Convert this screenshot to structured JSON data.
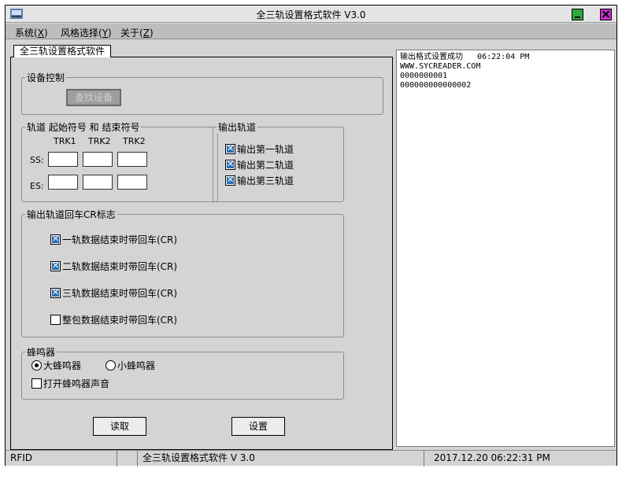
{
  "window": {
    "title": "全三轨设置格式软件 V3.0"
  },
  "menu": [
    {
      "label": "系统",
      "key": "X"
    },
    {
      "label": "风格选择",
      "key": "Y"
    },
    {
      "label": "关于",
      "key": "Z"
    }
  ],
  "tab": {
    "label": "全三轨设置格式软件"
  },
  "device": {
    "title": "设备控制",
    "find_button": "查找设备"
  },
  "sentinels": {
    "title": "轨道 起始符号 和 结束符号",
    "tracks": [
      "TRK1",
      "TRK2",
      "TRK2"
    ],
    "ss_label": "SS:",
    "es_label": "ES:",
    "ss_values": [
      "",
      "",
      ""
    ],
    "es_values": [
      "",
      "",
      ""
    ]
  },
  "output_tracks": {
    "title": "输出轨道",
    "items": [
      {
        "label": "输出第一轨道",
        "checked": true
      },
      {
        "label": "输出第二轨道",
        "checked": true
      },
      {
        "label": "输出第三轨道",
        "checked": true
      }
    ]
  },
  "cr": {
    "title": "输出轨道回车CR标志",
    "items": [
      {
        "label": "一轨数据结束时带回车(CR)",
        "checked": true
      },
      {
        "label": "二轨数据结束时带回车(CR)",
        "checked": true
      },
      {
        "label": "三轨数据结束时带回车(CR)",
        "checked": true
      },
      {
        "label": "整包数据结束时带回车(CR)",
        "checked": false
      }
    ]
  },
  "buzzer": {
    "title": "蜂鸣器",
    "large": "大蜂鸣器",
    "small": "小蜂鸣器",
    "selected": "large",
    "sound_label": "打开蜂鸣器声音",
    "sound_checked": false
  },
  "actions": {
    "read": "读取",
    "set": "设置"
  },
  "log": [
    "输出格式设置成功   06:22:04 PM",
    "WWW.SYCREADER.COM",
    "0000000001",
    "000000000000002"
  ],
  "status": {
    "mode": "RFID",
    "blank": "",
    "app": "全三轨设置格式软件 V 3.0",
    "datetime": "2017.12.20   06:22:31 PM"
  },
  "colors": {
    "background": "#d4d4d4",
    "checkbox_fill": "#2a6db0",
    "minimize": "#2fa83b",
    "close": "#c32ec8"
  }
}
